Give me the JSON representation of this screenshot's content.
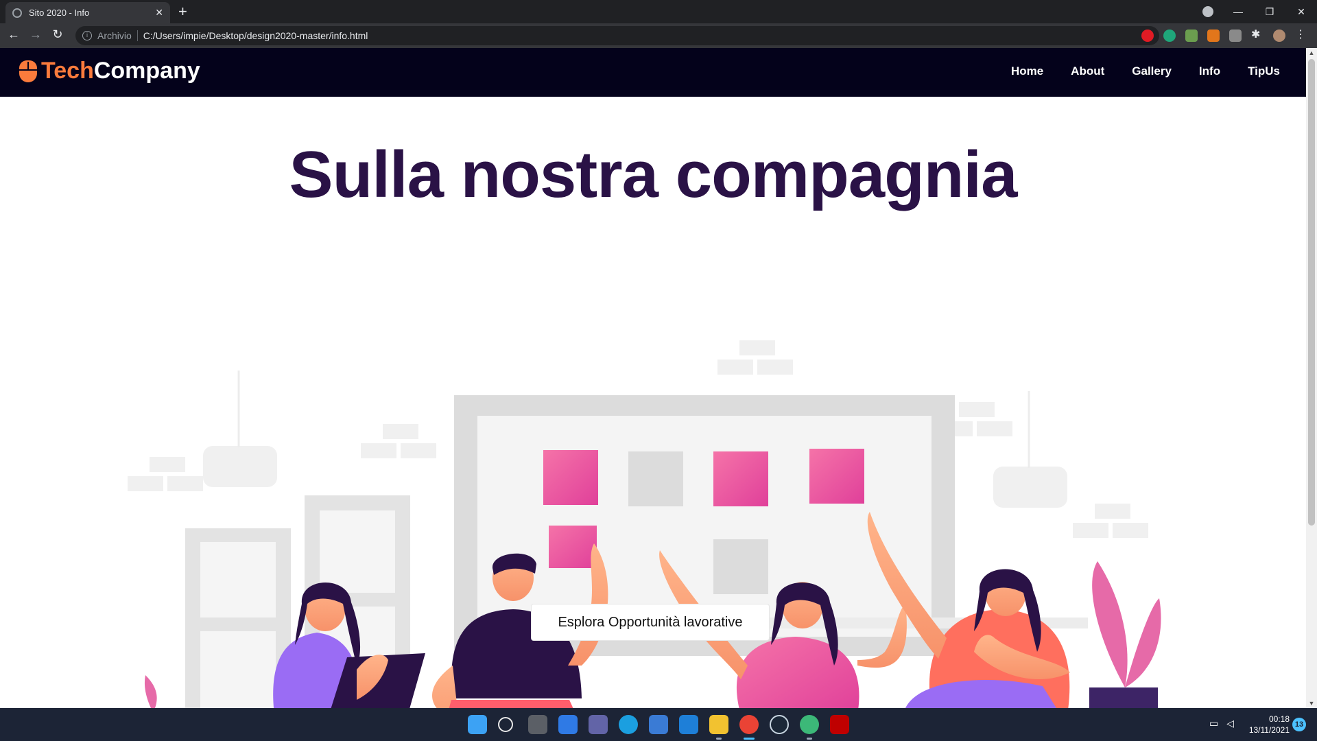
{
  "browser": {
    "tab_title": "Sito 2020 - Info",
    "tab_close": "✕",
    "new_tab": "+",
    "omnibox_label": "Archivio",
    "url": "C:/Users/impie/Desktop/design2020-master/info.html",
    "window_controls": [
      "—",
      "❐",
      "✕"
    ]
  },
  "site": {
    "brand_tech": "Tech",
    "brand_company": "Company",
    "menu": [
      "Home",
      "About",
      "Gallery",
      "Info",
      "TipUs"
    ],
    "hero_title": "Sulla nostra compagnia",
    "cta_label": "Esplora Opportunità lavorative"
  },
  "taskbar": {
    "time": "00:18",
    "date": "13/11/2021",
    "notifications": "13"
  },
  "colors": {
    "header_bg": "#04021b",
    "brand_orange": "#fb7b3c",
    "title_purple": "#2a1246",
    "sticky_pink": "#e94ba0"
  }
}
